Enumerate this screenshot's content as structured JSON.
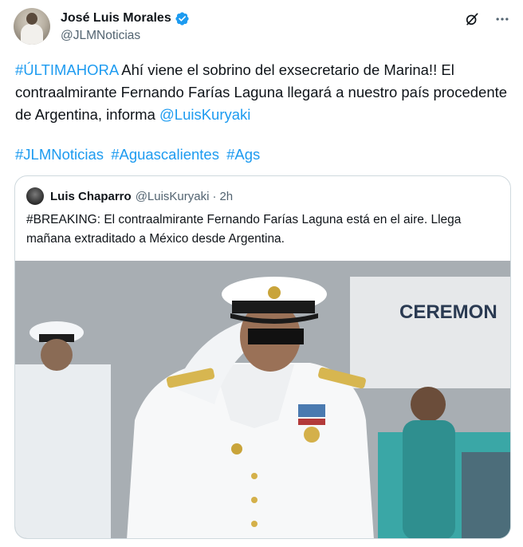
{
  "author": {
    "display_name": "José Luis Morales",
    "handle": "@JLMNoticias",
    "verified": true
  },
  "tweet": {
    "hashtag_lead": "#ÚLTIMAHORA",
    "text_part1": " Ahí viene el sobrino del exsecretario de Marina!! El contraalmirante Fernando Farías Laguna llegará a nuestro país procedente de Argentina, informa ",
    "mention": "@LuisKuryaki",
    "hashtags": [
      "#JLMNoticias",
      "#Aguascalientes",
      "#Ags"
    ]
  },
  "quote": {
    "display_name": "Luis Chaparro",
    "handle": "@LuisKuryaki",
    "separator": "·",
    "time": "2h",
    "text": "#BREAKING: El contraalmirante Fernando Farías Laguna está en el aire. Llega mañana extraditado a México desde Argentina.",
    "photo_sign_text": "CEREMON"
  },
  "icons": {
    "grok": "grok-icon",
    "more": "more-options-icon",
    "verified": "verified-badge-icon"
  },
  "colors": {
    "link": "#1d9bf0",
    "text": "#0f1419",
    "secondary": "#536471",
    "border": "#cfd9de"
  }
}
